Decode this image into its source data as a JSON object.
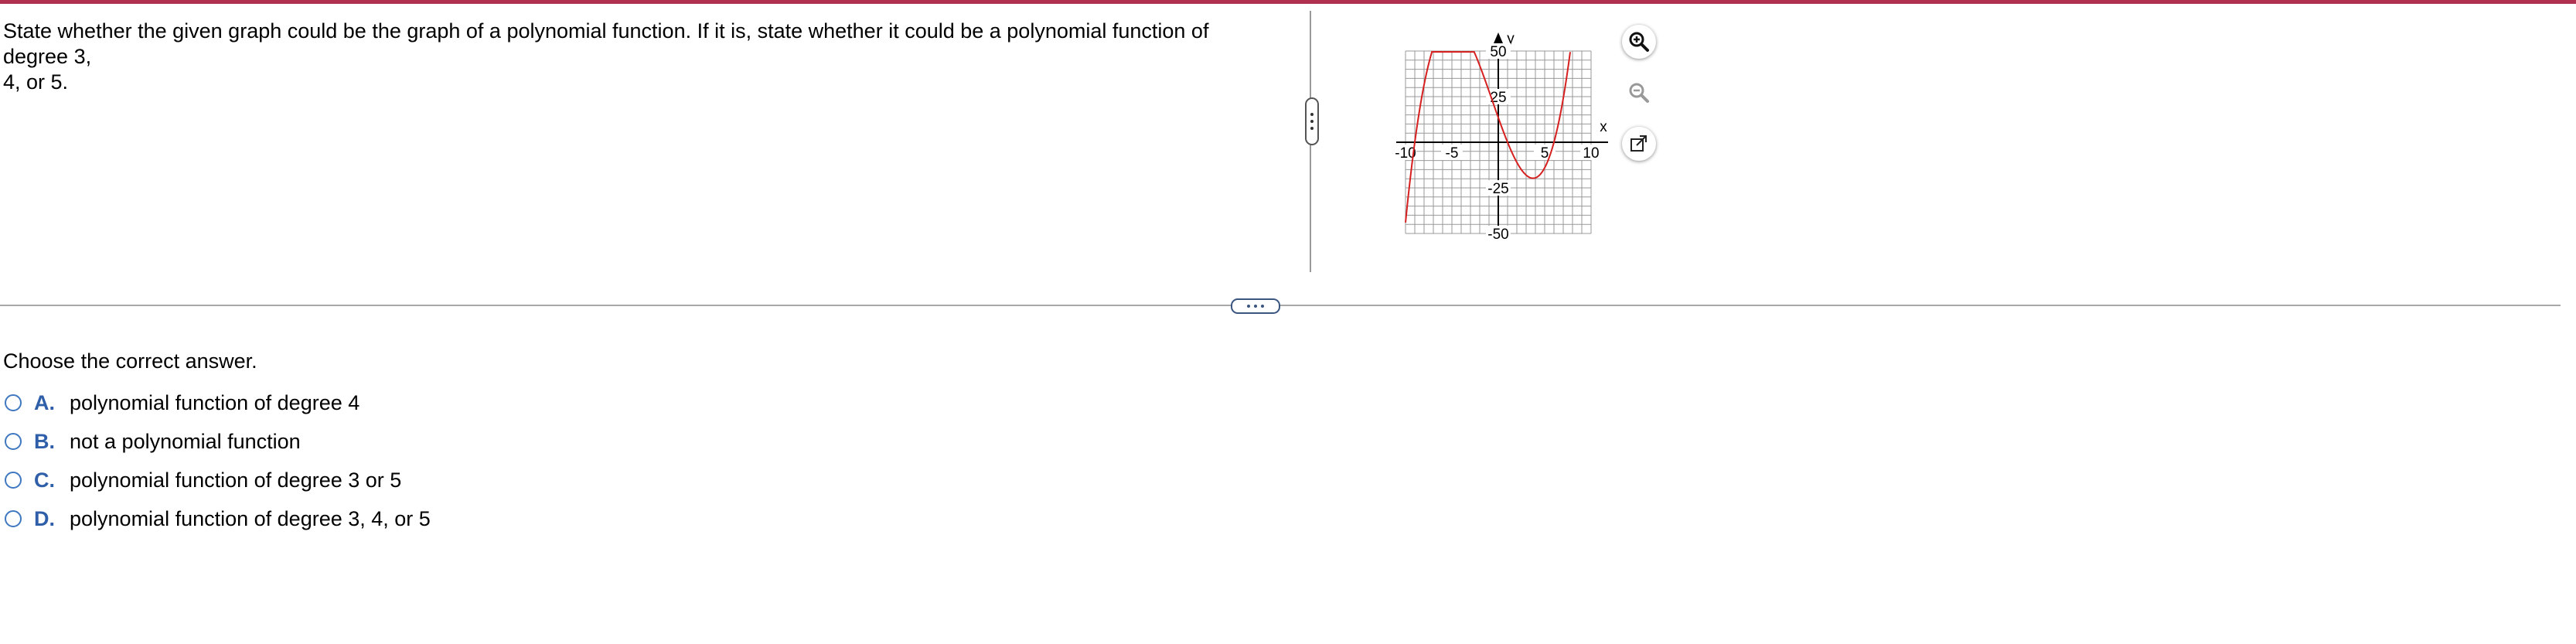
{
  "question": {
    "text_line1": "State whether the given graph could be the graph of a polynomial function. If it is, state whether it could be a polynomial function of degree 3,",
    "text_line2": "4, or 5."
  },
  "graph": {
    "x_axis_label": "x",
    "y_axis_label": "y",
    "x_range": [
      -10,
      10
    ],
    "y_range": [
      -50,
      50
    ],
    "x_ticks": [
      "-10",
      "-5",
      "5",
      "10"
    ],
    "y_ticks": [
      "50",
      "25",
      "-25",
      "-50"
    ],
    "curve_color": "#d62020"
  },
  "tools": {
    "zoom_in_icon": "zoom-in-icon",
    "zoom_out_icon": "zoom-out-icon",
    "popout_icon": "popout-icon"
  },
  "answer": {
    "prompt": "Choose the correct answer.",
    "options": [
      {
        "letter": "A.",
        "text": "polynomial function of degree 4"
      },
      {
        "letter": "B.",
        "text": "not a polynomial function"
      },
      {
        "letter": "C.",
        "text": "polynomial function of degree 3 or 5"
      },
      {
        "letter": "D.",
        "text": "polynomial function of degree 3, 4, or 5"
      }
    ]
  },
  "colors": {
    "accent_bar": "#b0304f",
    "option_letter": "#2f5fa8",
    "radio_border": "#3f78c0"
  }
}
